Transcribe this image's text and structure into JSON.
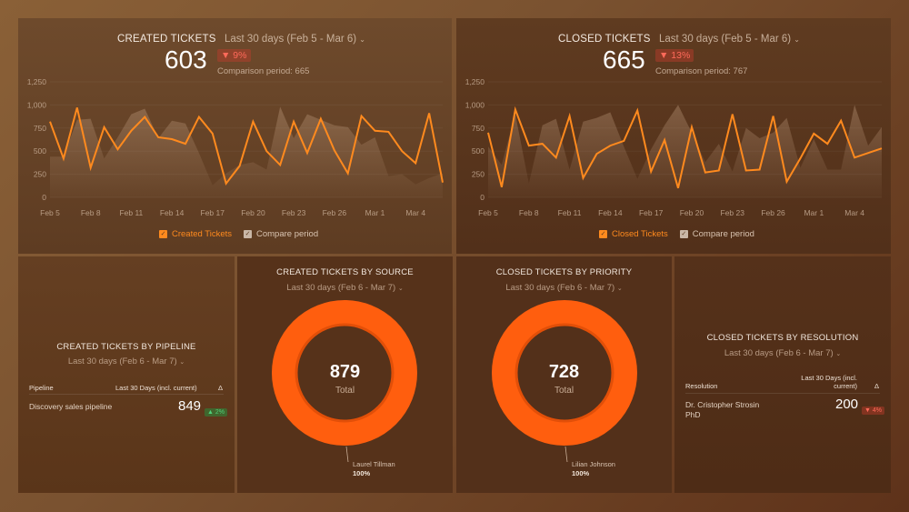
{
  "created_tickets": {
    "title": "CREATED TICKETS",
    "range": "Last 30 days (Feb 5 - Mar 6)",
    "value": "603",
    "change": "▼ 9%",
    "comparison": "Comparison period: 665",
    "legend": {
      "primary": "Created Tickets",
      "compare": "Compare period"
    }
  },
  "closed_tickets": {
    "title": "CLOSED TICKETS",
    "range": "Last 30 days (Feb 5 - Mar 6)",
    "value": "665",
    "change": "▼ 13%",
    "comparison": "Comparison period: 767",
    "legend": {
      "primary": "Closed Tickets",
      "compare": "Compare period"
    }
  },
  "by_pipeline": {
    "title": "CREATED TICKETS BY PIPELINE",
    "range": "Last 30 days (Feb 6 - Mar 7)",
    "headers": {
      "name": "Pipeline",
      "value": "Last 30 Days (incl. current)",
      "delta": "Δ"
    },
    "rows": [
      {
        "name": "Discovery sales pipeline",
        "value": "849",
        "delta": "▲ 2%"
      }
    ]
  },
  "by_source": {
    "title": "CREATED TICKETS BY SOURCE",
    "range": "Last 30 days (Feb 6 - Mar 7)",
    "total": "879",
    "total_label": "Total",
    "slices": [
      {
        "label": "Laurel Tillman",
        "pct": "100%",
        "value": 100
      }
    ]
  },
  "by_priority": {
    "title": "CLOSED TICKETS BY PRIORITY",
    "range": "Last 30 days (Feb 6 - Mar 7)",
    "total": "728",
    "total_label": "Total",
    "slices": [
      {
        "label": "Lilian Johnson",
        "pct": "100%",
        "value": 100
      }
    ]
  },
  "by_resolution": {
    "title": "CLOSED TICKETS BY RESOLUTION",
    "range": "Last 30 days (Feb 6 - Mar 7)",
    "headers": {
      "name": "Resolution",
      "value_line1": "Last 30 Days (incl.",
      "value_line2": "current)",
      "delta": "Δ"
    },
    "rows": [
      {
        "name_line1": "Dr. Cristopher Strosin",
        "name_line2": "PhD",
        "value": "200",
        "delta": "▼ 4%"
      }
    ]
  },
  "colors": {
    "accent": "#ff8a1e",
    "donut": "#ff5e0e",
    "compare_fill": "#c9a587"
  },
  "chart_data": [
    {
      "type": "line",
      "title": "Created Tickets",
      "x": [
        "Feb 5",
        "Feb 6",
        "Feb 7",
        "Feb 8",
        "Feb 9",
        "Feb 10",
        "Feb 11",
        "Feb 12",
        "Feb 13",
        "Feb 14",
        "Feb 15",
        "Feb 16",
        "Feb 17",
        "Feb 18",
        "Feb 19",
        "Feb 20",
        "Feb 21",
        "Feb 22",
        "Feb 23",
        "Feb 24",
        "Feb 25",
        "Feb 26",
        "Feb 27",
        "Feb 28",
        "Mar 1",
        "Mar 2",
        "Mar 3",
        "Mar 4",
        "Mar 5",
        "Mar 6"
      ],
      "xticks": [
        "Feb 5",
        "Feb 8",
        "Feb 11",
        "Feb 14",
        "Feb 17",
        "Feb 20",
        "Feb 23",
        "Feb 26",
        "Mar 1",
        "Mar 4"
      ],
      "yticks": [
        "0",
        "250",
        "500",
        "750",
        "1,000",
        "1,250"
      ],
      "ylim": [
        0,
        1250
      ],
      "grid": true,
      "legend": "bottom",
      "series": [
        {
          "name": "Created Tickets",
          "type": "line",
          "values": [
            820,
            420,
            970,
            320,
            760,
            520,
            720,
            870,
            650,
            630,
            580,
            870,
            690,
            150,
            340,
            820,
            500,
            350,
            820,
            480,
            850,
            510,
            260,
            880,
            720,
            710,
            500,
            370,
            910,
            160
          ]
        },
        {
          "name": "Compare period",
          "type": "area",
          "values": [
            440,
            440,
            840,
            850,
            420,
            650,
            900,
            960,
            640,
            830,
            800,
            480,
            130,
            260,
            350,
            380,
            300,
            980,
            640,
            900,
            840,
            780,
            760,
            570,
            650,
            230,
            250,
            140,
            210,
            260
          ]
        }
      ]
    },
    {
      "type": "line",
      "title": "Closed Tickets",
      "x": [
        "Feb 5",
        "Feb 6",
        "Feb 7",
        "Feb 8",
        "Feb 9",
        "Feb 10",
        "Feb 11",
        "Feb 12",
        "Feb 13",
        "Feb 14",
        "Feb 15",
        "Feb 16",
        "Feb 17",
        "Feb 18",
        "Feb 19",
        "Feb 20",
        "Feb 21",
        "Feb 22",
        "Feb 23",
        "Feb 24",
        "Feb 25",
        "Feb 26",
        "Feb 27",
        "Feb 28",
        "Mar 1",
        "Mar 2",
        "Mar 3",
        "Mar 4",
        "Mar 5",
        "Mar 6"
      ],
      "xticks": [
        "Feb 5",
        "Feb 8",
        "Feb 11",
        "Feb 14",
        "Feb 17",
        "Feb 20",
        "Feb 23",
        "Feb 26",
        "Mar 1",
        "Mar 4"
      ],
      "yticks": [
        "0",
        "250",
        "500",
        "750",
        "1,000",
        "1,250"
      ],
      "ylim": [
        0,
        1250
      ],
      "grid": true,
      "legend": "bottom",
      "series": [
        {
          "name": "Closed Tickets",
          "type": "line",
          "values": [
            700,
            110,
            950,
            560,
            580,
            430,
            880,
            210,
            470,
            560,
            610,
            940,
            280,
            620,
            100,
            760,
            270,
            290,
            900,
            290,
            300,
            880,
            170,
            420,
            690,
            580,
            830,
            430,
            480,
            530
          ]
        },
        {
          "name": "Compare period",
          "type": "area",
          "values": [
            550,
            350,
            900,
            150,
            780,
            850,
            300,
            820,
            860,
            920,
            550,
            200,
            520,
            780,
            1000,
            700,
            380,
            580,
            280,
            750,
            640,
            700,
            860,
            320,
            630,
            300,
            300,
            1000,
            560,
            760
          ]
        }
      ]
    },
    {
      "type": "pie",
      "title": "Created Tickets by Source",
      "categories": [
        "Laurel Tillman"
      ],
      "values": [
        100
      ],
      "total": 879
    },
    {
      "type": "pie",
      "title": "Closed Tickets by Priority",
      "categories": [
        "Lilian Johnson"
      ],
      "values": [
        100
      ],
      "total": 728
    }
  ]
}
